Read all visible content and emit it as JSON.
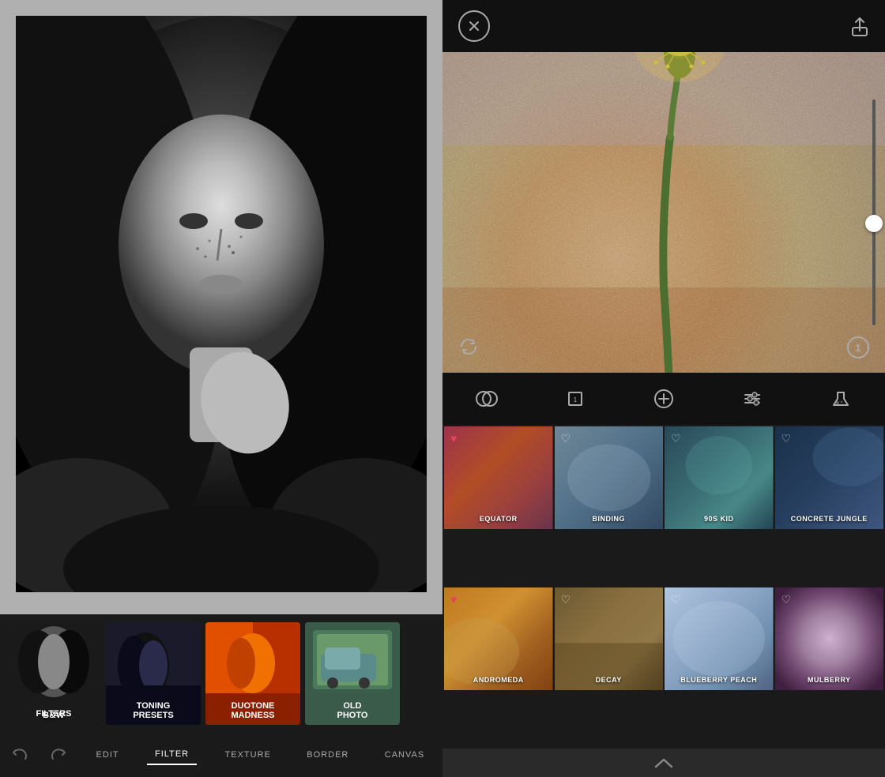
{
  "left": {
    "filter_strip": {
      "items": [
        {
          "id": "bw-filters",
          "label": "B&W\nFILTERS",
          "label_line1": "B&W",
          "label_line2": "FILTERS"
        },
        {
          "id": "toning-presets",
          "label": "TONING\nPRESETS",
          "label_line1": "TONING",
          "label_line2": "PRESETS"
        },
        {
          "id": "duotone-madness",
          "label": "DUOTONE\nMADNESS",
          "label_line1": "DUOTONE",
          "label_line2": "MADNESS"
        },
        {
          "id": "old-photo",
          "label": "OLD\nPHOTO",
          "label_line1": "OLD",
          "label_line2": "PHOTO"
        }
      ]
    },
    "toolbar": {
      "undo_label": "",
      "redo_label": "",
      "edit_label": "EDIT",
      "filter_label": "FILTER",
      "texture_label": "TEXTURE",
      "border_label": "BORDER",
      "canvas_label": "CANVAS"
    }
  },
  "right": {
    "header": {
      "close_icon": "×",
      "share_icon": "↑"
    },
    "slider": {
      "value": 55
    },
    "badge": {
      "value": "1"
    },
    "edit_tools": [
      {
        "id": "blend",
        "icon": "blend"
      },
      {
        "id": "layers",
        "icon": "layers"
      },
      {
        "id": "add",
        "icon": "add"
      },
      {
        "id": "adjust",
        "icon": "adjust"
      },
      {
        "id": "lab",
        "icon": "lab"
      }
    ],
    "filter_grid": {
      "items": [
        {
          "id": "equator",
          "label": "EQUATOR",
          "heart": true
        },
        {
          "id": "binding",
          "label": "BINDING",
          "heart": false
        },
        {
          "id": "90s-kid",
          "label": "90S KID",
          "heart": false
        },
        {
          "id": "concrete-jungle",
          "label": "CONCRETE JUNGLE",
          "heart": false
        },
        {
          "id": "andromeda",
          "label": "ANDROMEDA",
          "heart": true
        },
        {
          "id": "decay",
          "label": "DECAY",
          "heart": false
        },
        {
          "id": "blueberry-peach",
          "label": "BLUEBERRY PEACH",
          "heart": false
        },
        {
          "id": "mulberry",
          "label": "MULBERRY",
          "heart": false
        }
      ]
    }
  }
}
